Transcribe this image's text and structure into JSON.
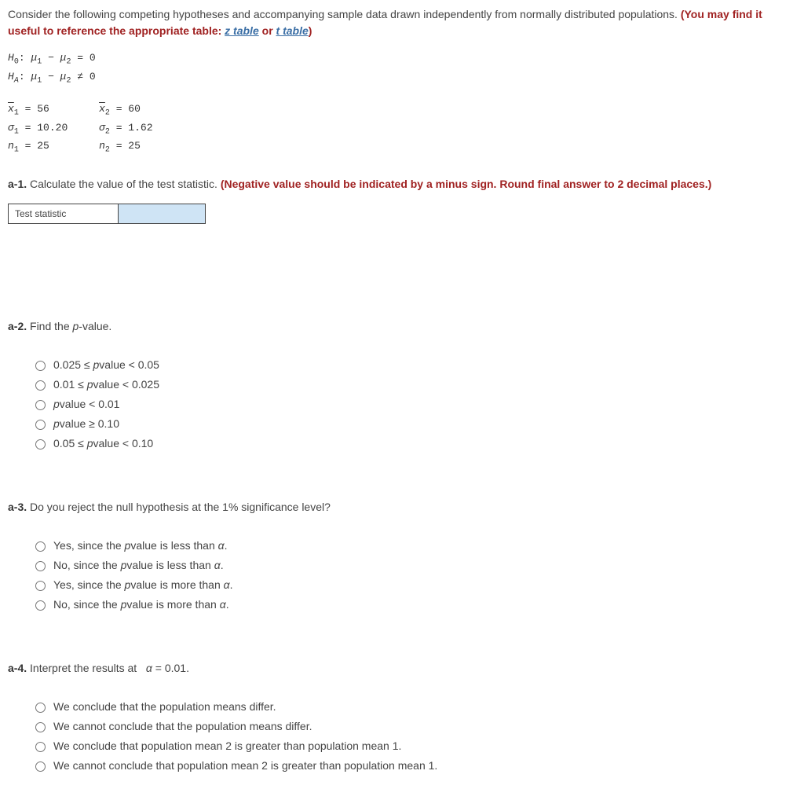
{
  "intro": {
    "text_1": "Consider the following competing hypotheses and accompanying sample data drawn independently from normally distributed populations. ",
    "bold_prefix": "(You may find it useful to reference the appropriate table: ",
    "link_z": "z table",
    "or": " or ",
    "link_t": "t table",
    "bold_suffix": ")"
  },
  "hypotheses": {
    "h0_html": "H₀: μ₁ − μ₂ = 0",
    "ha_html": "H_A: μ₁ − μ₂ ≠ 0"
  },
  "data": {
    "x1_label": "x̄₁ = ",
    "x1_val": "56",
    "sigma1_label": "σ₁ = ",
    "sigma1_val": "10.20",
    "n1_label": "n₁ = ",
    "n1_val": "25",
    "x2_label": "x̄₂ = ",
    "x2_val": "60",
    "sigma2_label": "σ₂ = ",
    "sigma2_val": "1.62",
    "n2_label": "n₂ = ",
    "n2_val": "25"
  },
  "a1": {
    "num": "a-1.",
    "text": " Calculate the value of the test statistic. ",
    "bold": "(Negative value should be indicated by a minus sign. Round final answer to 2 decimal places.)",
    "input_label": "Test statistic",
    "input_value": ""
  },
  "a2": {
    "num": "a-2.",
    "text_before_p": " Find the ",
    "p_letter": "p",
    "text_after_p": "-value.",
    "opts": [
      "0.025 ≤ p-value < 0.05",
      "0.01 ≤ p-value < 0.025",
      "p-value < 0.01",
      "p-value ≥ 0.10",
      "0.05 ≤ p-value < 0.10"
    ]
  },
  "a3": {
    "num": "a-3.",
    "text": " Do you reject the null hypothesis at the 1% significance level?",
    "opts": [
      "Yes, since the p-value is less than α.",
      "No, since the p-value is less than α.",
      "Yes, since the p-value is more than α.",
      "No, since the p-value is more than α."
    ]
  },
  "a4": {
    "num": "a-4.",
    "text": " Interpret the results at   α = 0.01.",
    "opts": [
      "We conclude that the population means differ.",
      "We cannot conclude that the population means differ.",
      "We conclude that population mean 2 is greater than population mean 1.",
      "We cannot conclude that population mean 2 is greater than population mean 1."
    ]
  }
}
